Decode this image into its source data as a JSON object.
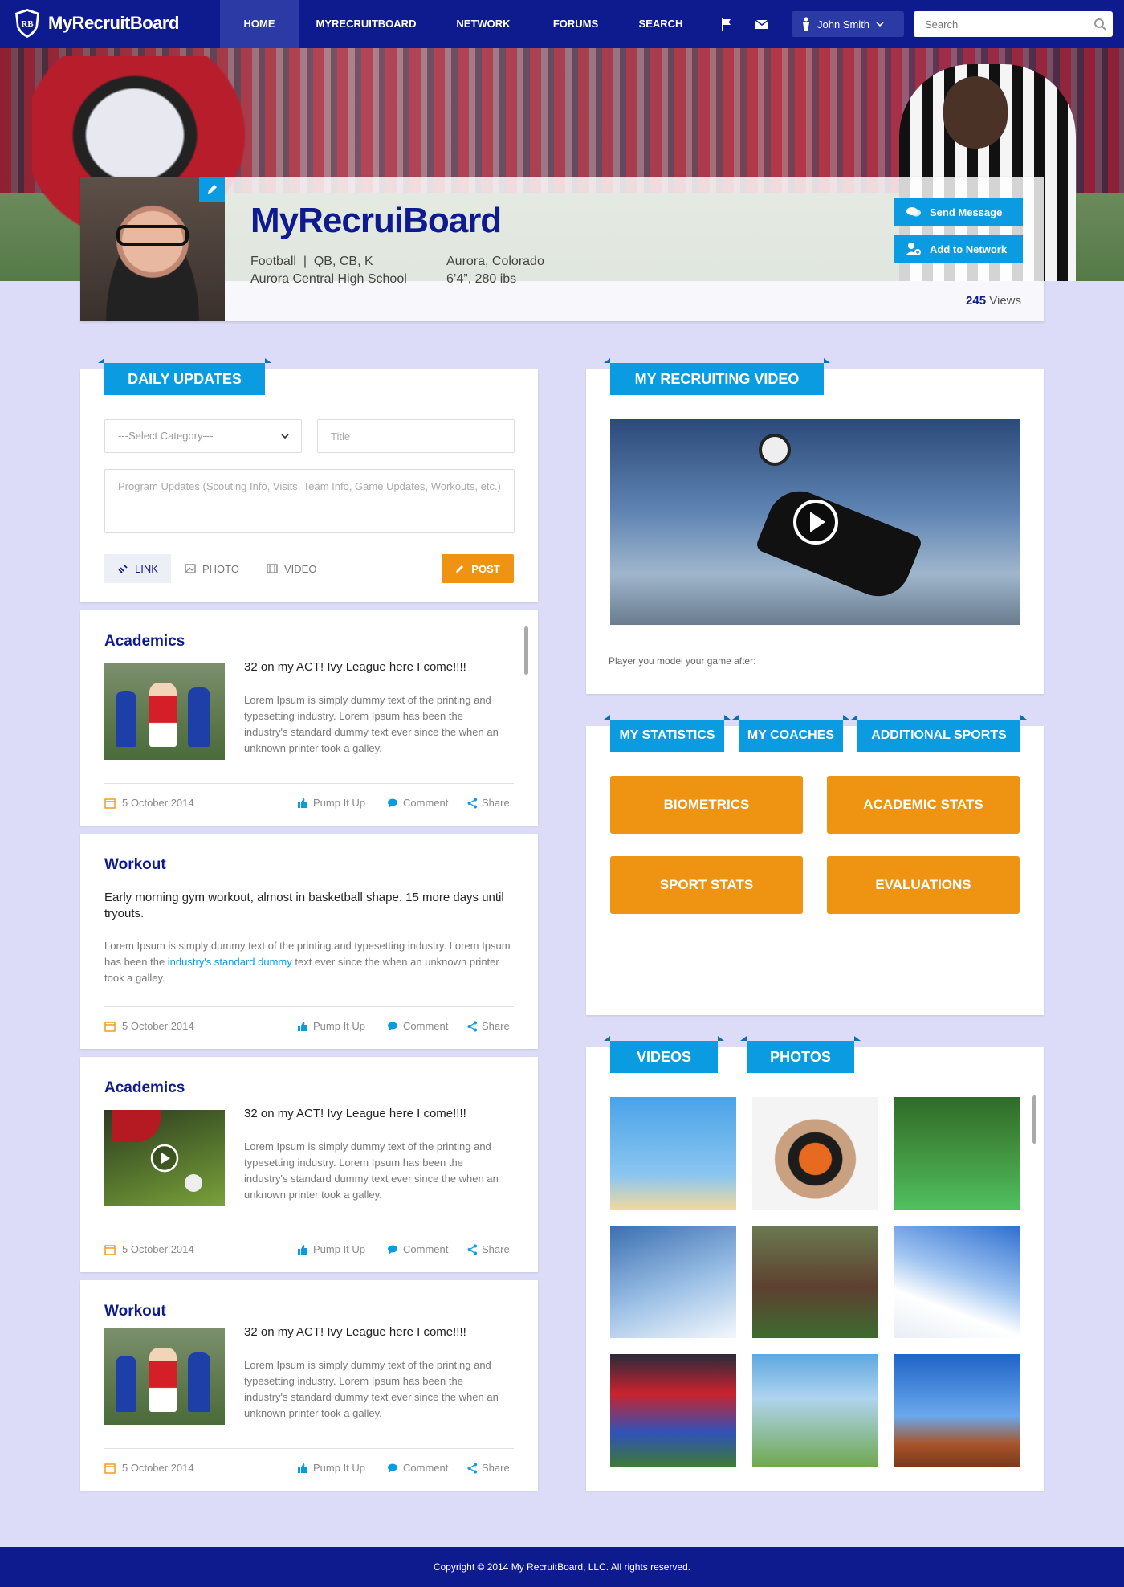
{
  "nav": {
    "brand": "MyRecruitBoard",
    "brand_mark": "RB",
    "items": [
      {
        "label": "HOME",
        "active": true
      },
      {
        "label": "MYRECRUITBOARD",
        "active": false
      },
      {
        "label": "NETWORK",
        "active": false
      },
      {
        "label": "FORUMS",
        "active": false
      },
      {
        "label": "SEARCH",
        "active": false
      }
    ],
    "icons": [
      "flag-icon",
      "envelope-icon"
    ],
    "user_name": "John Smith",
    "search_placeholder": "Search"
  },
  "profile": {
    "name": "MyRecruiBoard",
    "sport_line": "Football  |  QB, CB, K",
    "school": "Aurora Central High School",
    "location": "Aurora, Colorado",
    "size": "6’4”, 280 ibs",
    "send_message": "Send Message",
    "add_network": "Add to Network",
    "views_count": "245",
    "views_label": "Views"
  },
  "daily_updates": {
    "title": "DAILY UPDATES",
    "category_placeholder": "---Select Category---",
    "title_placeholder": "Title",
    "body_placeholder": "Program Updates (Scouting Info, Visits, Team Info, Game Updates, Workouts, etc.)",
    "attach": [
      {
        "label": "LINK",
        "icon": "link-icon"
      },
      {
        "label": "PHOTO",
        "icon": "photo-icon"
      },
      {
        "label": "VIDEO",
        "icon": "film-icon"
      }
    ],
    "post_label": "POST"
  },
  "posts": [
    {
      "category": "Academics",
      "headline": "32 on my ACT! Ivy League here I come!!!!",
      "body": "Lorem Ipsum is simply dummy text of the printing and typesetting industry. Lorem Ipsum has been the industry's standard dummy text ever since the when an unknown printer took a galley.",
      "date": "5 October 2014",
      "thumb": "soccer-players-photo"
    },
    {
      "category": "Workout",
      "headline": "Early morning gym workout, almost in basketball shape. 15 more days until tryouts.",
      "body_pre": "Lorem Ipsum is simply dummy text of the printing and typesetting industry. Lorem Ipsum has been the ",
      "body_link": "industry's standard dummy",
      "body_post": " text ever since the when an unknown printer took a galley.",
      "date": "5 October 2014"
    },
    {
      "category": "Academics",
      "headline": "32 on my ACT! Ivy League here I come!!!!",
      "body": "Lorem Ipsum is simply dummy text of the printing and typesetting industry. Lorem Ipsum has been the industry's standard dummy text ever since the when an unknown printer took a galley.",
      "date": "5 October 2014",
      "thumb": "soccer-kick-video"
    },
    {
      "category": "Workout",
      "headline": "32 on my ACT! Ivy League here I come!!!!",
      "body": "Lorem Ipsum is simply dummy text of the printing and typesetting industry. Lorem Ipsum has been the industry's standard dummy text ever since the when an unknown printer took a galley.",
      "date": "5 October 2014",
      "thumb": "soccer-players-photo"
    }
  ],
  "post_actions": {
    "pump": "Pump It Up",
    "comment": "Comment",
    "share": "Share"
  },
  "video_panel": {
    "title": "MY RECRUITING VIDEO",
    "caption": "Player you model your game after:"
  },
  "stats_panel": {
    "tabs": [
      "MY STATISTICS",
      "MY COACHES",
      "ADDITIONAL SPORTS"
    ],
    "buttons": [
      "BIOMETRICS",
      "ACADEMIC STATS",
      "SPORT STATS",
      "EVALUATIONS"
    ]
  },
  "media_panel": {
    "tabs": [
      "VIDEOS",
      "PHOTOS"
    ],
    "tiles": [
      "jumping-friends-photo",
      "sprinter-photo",
      "field-hockey-photo",
      "snowboarder-photo",
      "polo-photo",
      "skier-photo",
      "soccer-match-photo",
      "kids-running-photo",
      "motocross-photo"
    ]
  },
  "footer": {
    "copyright": "Copyright © 2014 My RecruitBoard, LLC. All rights reserved."
  },
  "colors": {
    "navy": "#0d1b8f",
    "accent": "#0a9be0",
    "orange": "#ef9412",
    "background": "#dcdcf8"
  }
}
